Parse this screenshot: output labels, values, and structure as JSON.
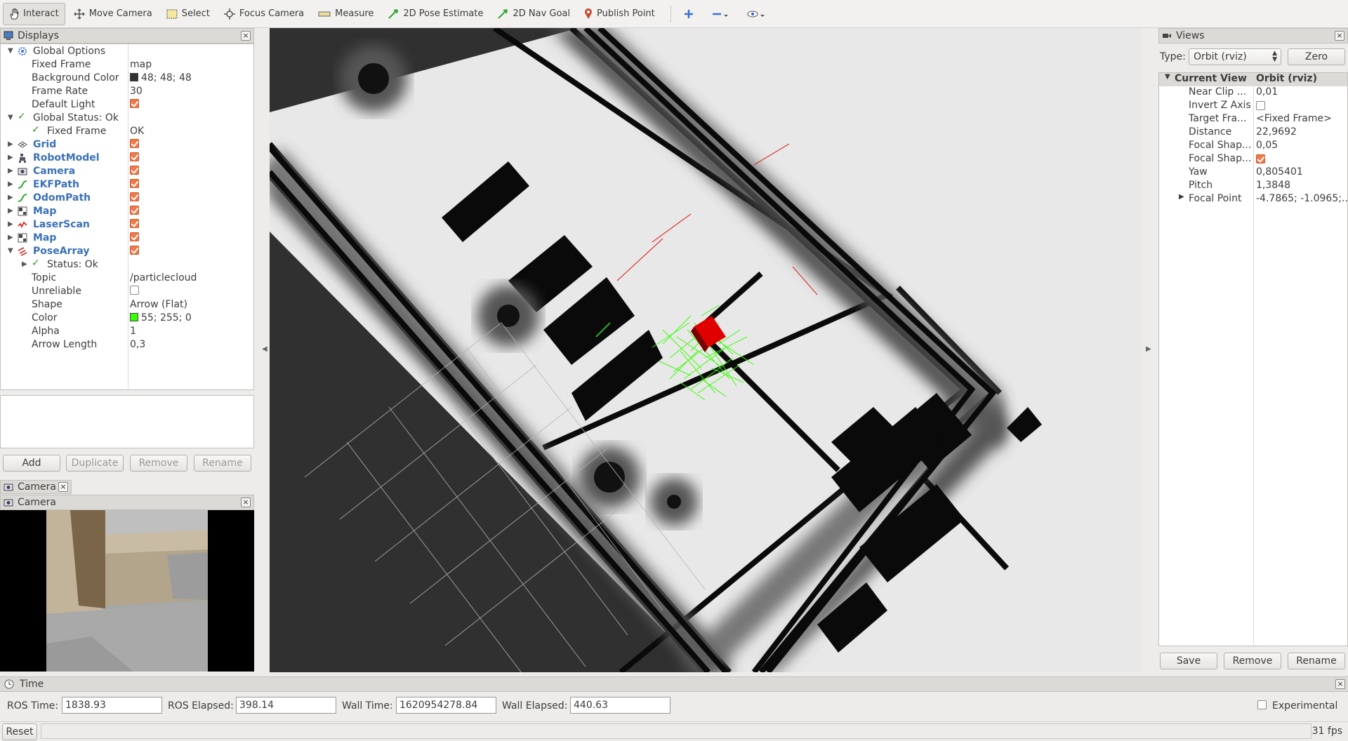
{
  "toolbar": {
    "tools": [
      {
        "label": "Interact",
        "icon": "hand-icon"
      },
      {
        "label": "Move Camera",
        "icon": "move-camera-icon"
      },
      {
        "label": "Select",
        "icon": "select-icon"
      },
      {
        "label": "Focus Camera",
        "icon": "focus-camera-icon"
      },
      {
        "label": "Measure",
        "icon": "ruler-icon"
      },
      {
        "label": "2D Pose Estimate",
        "icon": "pose-arrow-icon"
      },
      {
        "label": "2D Nav Goal",
        "icon": "nav-goal-arrow-icon"
      },
      {
        "label": "Publish Point",
        "icon": "map-pin-icon"
      }
    ]
  },
  "displays": {
    "title": "Displays",
    "global_options": "Global Options",
    "fixed_frame_label": "Fixed Frame",
    "fixed_frame_value": "map",
    "bg_color_label": "Background Color",
    "bg_color_value": "48; 48; 48",
    "bg_color_hex": "#303030",
    "frame_rate_label": "Frame Rate",
    "frame_rate_value": "30",
    "default_light_label": "Default Light",
    "global_status": "Global Status: Ok",
    "status_fixed_frame": "Fixed Frame",
    "status_fixed_frame_value": "OK",
    "items": {
      "grid": "Grid",
      "robot_model": "RobotModel",
      "camera": "Camera",
      "ekf_path": "EKFPath",
      "odom_path": "OdomPath",
      "map1": "Map",
      "laser_scan": "LaserScan",
      "map2": "Map",
      "pose_array": "PoseArray"
    },
    "pose_array_status": "Status: Ok",
    "topic_label": "Topic",
    "topic_value": "/particlecloud",
    "unreliable_label": "Unreliable",
    "shape_label": "Shape",
    "shape_value": "Arrow (Flat)",
    "color_label": "Color",
    "color_value": "55; 255; 0",
    "color_hex": "#37ff00",
    "alpha_label": "Alpha",
    "alpha_value": "1",
    "arrow_length_label": "Arrow Length",
    "arrow_length_value": "0,3"
  },
  "display_buttons": {
    "add": "Add",
    "duplicate": "Duplicate",
    "remove": "Remove",
    "rename": "Rename"
  },
  "camera_panel": {
    "tab": "Camera",
    "title": "Camera"
  },
  "views": {
    "title": "Views",
    "type_label": "Type:",
    "type_value": "Orbit (rviz)",
    "zero": "Zero",
    "current_view": "Current View",
    "current_view_type": "Orbit (rviz)",
    "near_clip_label": "Near Clip ...",
    "near_clip_value": "0,01",
    "invert_z_label": "Invert Z Axis",
    "target_frame_label": "Target Fra...",
    "target_frame_value": "<Fixed Frame>",
    "distance_label": "Distance",
    "distance_value": "22,9692",
    "focal_shape_size_label": "Focal Shap...",
    "focal_shape_size_value": "0,05",
    "focal_shape_fixed_label": "Focal Shap...",
    "yaw_label": "Yaw",
    "yaw_value": "0,805401",
    "pitch_label": "Pitch",
    "pitch_value": "1,3848",
    "focal_point_label": "Focal Point",
    "focal_point_value": "-4.7865; -1.0965;...",
    "save": "Save",
    "remove": "Remove",
    "rename": "Rename"
  },
  "time": {
    "title": "Time",
    "ros_time_label": "ROS Time:",
    "ros_time_value": "1838.93",
    "ros_elapsed_label": "ROS Elapsed:",
    "ros_elapsed_value": "398.14",
    "wall_time_label": "Wall Time:",
    "wall_time_value": "1620954278.84",
    "wall_elapsed_label": "Wall Elapsed:",
    "wall_elapsed_value": "440.63",
    "experimental_label": "Experimental",
    "reset": "Reset",
    "fps": "31 fps"
  }
}
